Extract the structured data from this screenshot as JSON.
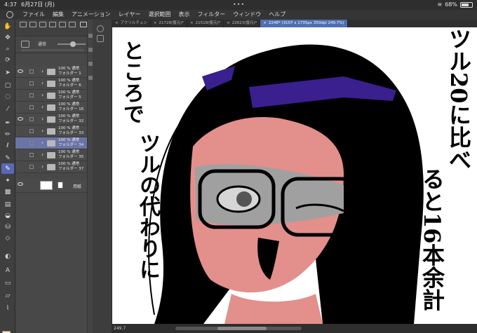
{
  "status": {
    "time": "4:37",
    "date": "6月27日 (月)",
    "battery": "68%",
    "battery_level": 0.68
  },
  "menu": [
    "ファイル",
    "編集",
    "アニメーション",
    "レイヤー",
    "選択範囲",
    "表示",
    "フィルター",
    "ウィンドウ",
    "ヘルプ"
  ],
  "blend": {
    "mode": "通常"
  },
  "layers": [
    {
      "opacity": "100 % 通常",
      "name": "フォルダー 1",
      "visible": true,
      "selected": false
    },
    {
      "opacity": "100 % 通常",
      "name": "フォルダー 6",
      "visible": false,
      "selected": false
    },
    {
      "opacity": "100 % 通常",
      "name": "フォルダー 5",
      "visible": false,
      "selected": false
    },
    {
      "opacity": "100 % 通常",
      "name": "フォルダー 16",
      "visible": false,
      "selected": false
    },
    {
      "opacity": "100 % 通常",
      "name": "フォルダー 32",
      "visible": true,
      "selected": false
    },
    {
      "opacity": "100 % 通常",
      "name": "フォルダー 33",
      "visible": false,
      "selected": false
    },
    {
      "opacity": "100 % 通常",
      "name": "フォルダー 34",
      "visible": false,
      "selected": true
    },
    {
      "opacity": "100 % 通常",
      "name": "フォルダー 35",
      "visible": false,
      "selected": false
    },
    {
      "opacity": "100 % 通常",
      "name": "フォルダー 37",
      "visible": false,
      "selected": false
    }
  ],
  "paper_layer": {
    "name": "用紙"
  },
  "tabs": [
    {
      "label": "アクリルチュン",
      "active": false
    },
    {
      "label": "21728(復元)*",
      "active": false
    },
    {
      "label": "21518(復元)*",
      "active": false
    },
    {
      "label": "22623(復元)*",
      "active": false
    },
    {
      "label": "2248* (3107 x 1735px 350dpi 249.7%)",
      "active": true
    }
  ],
  "canvas_text": {
    "left_col1": "ところで",
    "left_col2": "ツルの代わりに",
    "right_col1": "ツル20に比べ",
    "right_col2": "ると16本余計"
  },
  "zoom": "249.7"
}
